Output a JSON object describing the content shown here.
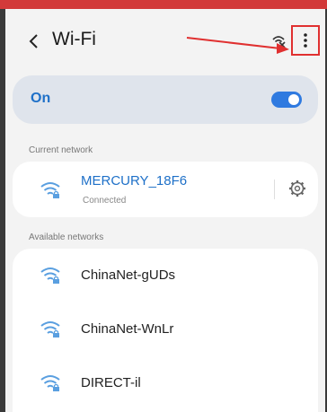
{
  "header": {
    "title": "Wi-Fi",
    "back_icon": "chevron-left-icon",
    "wifi_x_icon": "wifi-off-icon",
    "more_icon": "more-vertical-icon"
  },
  "toggle": {
    "label": "On",
    "state": "on",
    "accent_color": "#2f7ae0"
  },
  "current_network": {
    "section_label": "Current network",
    "name": "MERCURY_18F6",
    "status": "Connected",
    "settings_icon": "gear-icon"
  },
  "available_networks": {
    "section_label": "Available networks",
    "items": [
      {
        "name": "ChinaNet-gUDs",
        "icon": "wifi-lock-icon"
      },
      {
        "name": "ChinaNet-WnLr",
        "icon": "wifi-lock-icon"
      },
      {
        "name": "DIRECT-il",
        "icon": "wifi-lock-icon"
      }
    ]
  },
  "annotation": {
    "highlight_color": "#e03030"
  }
}
